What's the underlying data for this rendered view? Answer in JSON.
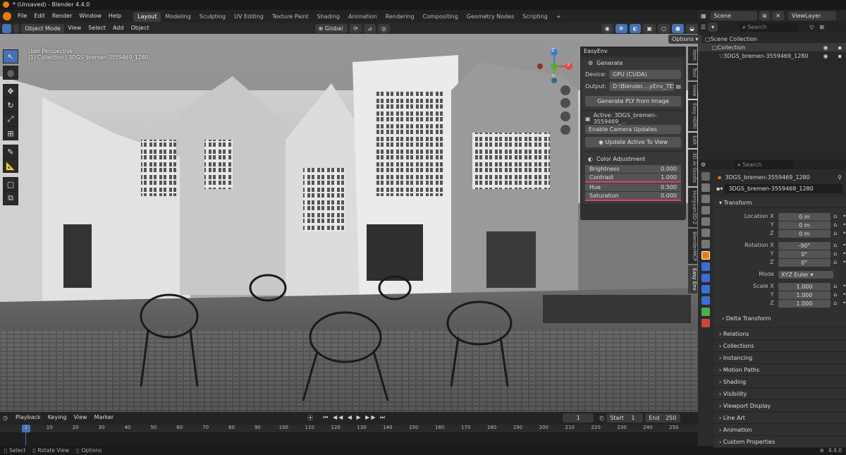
{
  "title": "* (Unsaved) - Blender 4.4.0",
  "menus": [
    "File",
    "Edit",
    "Render",
    "Window",
    "Help"
  ],
  "workspaces": [
    "Layout",
    "Modeling",
    "Sculpting",
    "UV Editing",
    "Texture Paint",
    "Shading",
    "Animation",
    "Rendering",
    "Compositing",
    "Geometry Nodes",
    "Scripting"
  ],
  "scene": {
    "name": "Scene",
    "view_layer": "ViewLayer"
  },
  "viewport_header": {
    "mode": "Object Mode",
    "menus": [
      "View",
      "Select",
      "Add",
      "Object"
    ],
    "orientation": "Global",
    "options": "Options"
  },
  "viewport": {
    "info_line1": "User Perspective",
    "info_line2": "(1) Collection | 3DGS_bremen-3559469_1280",
    "axes": {
      "x": "X",
      "y": "Y",
      "z": "Z"
    }
  },
  "npanel": {
    "title": "EasyEnv",
    "generate": {
      "header": "Generate",
      "device_label": "Device:",
      "device": "GPU (CUDA)",
      "output_label": "Output:",
      "output": "D:\\Blender....yEnv_TEST\\",
      "generate_btn": "Generate PLY from Image"
    },
    "active": {
      "label": "Active: 3DGS_bremen-3559469_...",
      "camera_updates": "Enable Camera Updates",
      "update_btn": "Update Active To View"
    },
    "color": {
      "header": "Color Adjustment",
      "sliders": [
        {
          "label": "Brightness",
          "value": "0.000"
        },
        {
          "label": "Contrast",
          "value": "1.000"
        },
        {
          "label": "Hue",
          "value": "0.500"
        },
        {
          "label": "Saturation",
          "value": "0.000"
        }
      ]
    }
  },
  "side_tabs": [
    "Item",
    "Tool",
    "View",
    "Easy HDRI",
    "Edit",
    "3D AI Studio",
    "Hunyuan3D-2",
    "BlenderMCP",
    "Easy Env"
  ],
  "timeline": {
    "menus": [
      "Playback",
      "Keying",
      "View",
      "Marker"
    ],
    "current": "1",
    "start_label": "Start",
    "start": "1",
    "end_label": "End",
    "end": "250",
    "ticks": [
      "1",
      "10",
      "20",
      "30",
      "40",
      "50",
      "60",
      "70",
      "80",
      "90",
      "100",
      "110",
      "120",
      "130",
      "140",
      "150",
      "160",
      "170",
      "180",
      "190",
      "200",
      "210",
      "220",
      "230",
      "240",
      "250"
    ]
  },
  "status": {
    "select": "Select",
    "rotate": "Rotate View",
    "options": "Options",
    "version": "4.4.0"
  },
  "outliner": {
    "search_placeholder": "Search",
    "items": [
      {
        "label": "Scene Collection"
      },
      {
        "label": "Collection"
      },
      {
        "label": "3DGS_bremen-3559469_1280"
      }
    ]
  },
  "properties": {
    "search_placeholder": "Search",
    "object_name": "3DGS_bremen-3559469_1280",
    "object_field": "3DGS_bremen-3559469_1280",
    "transform_header": "Transform",
    "location": {
      "label": "Location X",
      "y": "Y",
      "z": "Z",
      "values": [
        "0 m",
        "0 m",
        "0 m"
      ]
    },
    "rotation": {
      "label": "Rotation X",
      "y": "Y",
      "z": "Z",
      "values": [
        "-90°",
        "0°",
        "0°"
      ]
    },
    "mode_label": "Mode",
    "mode": "XYZ Euler",
    "scale": {
      "label": "Scale X",
      "y": "Y",
      "z": "Z",
      "values": [
        "1.000",
        "1.000",
        "1.000"
      ]
    },
    "delta": "Delta Transform",
    "sections": [
      "Relations",
      "Collections",
      "Instancing",
      "Motion Paths",
      "Shading",
      "Visibility",
      "Viewport Display",
      "Line Art",
      "Animation",
      "Custom Properties"
    ]
  },
  "colors": {
    "accent": "#4772b3",
    "highlight": "#e0406a",
    "orange": "#e87d0d"
  }
}
